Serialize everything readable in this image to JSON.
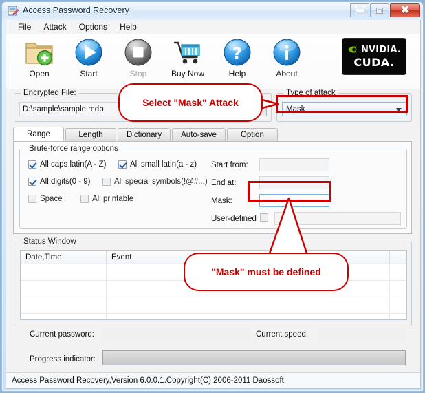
{
  "window": {
    "title": "Access Password Recovery",
    "icon": "app-icon",
    "buttons": {
      "minimize": "minimize",
      "maximize": "maximize",
      "close": "close"
    }
  },
  "menu": {
    "items": [
      {
        "label": "File"
      },
      {
        "label": "Attack"
      },
      {
        "label": "Options"
      },
      {
        "label": "Help"
      }
    ]
  },
  "toolbar": {
    "buttons": [
      {
        "label": "Open",
        "icon": "open-folder-icon",
        "disabled": false
      },
      {
        "label": "Start",
        "icon": "play-icon",
        "disabled": false
      },
      {
        "label": "Stop",
        "icon": "stop-icon",
        "disabled": true
      },
      {
        "label": "Buy Now",
        "icon": "shopping-cart-icon",
        "disabled": false
      },
      {
        "label": "Help",
        "icon": "question-mark-icon",
        "disabled": false
      },
      {
        "label": "About",
        "icon": "info-icon",
        "disabled": false
      }
    ],
    "cuda_badge": {
      "brand": "NVIDIA.",
      "product": "CUDA.",
      "logo_color": "#76b900",
      "background": "#080808"
    }
  },
  "encrypted_file": {
    "caption": "Encrypted File:",
    "path_value": "D:\\sample\\sample.mdb",
    "browse_label": "..."
  },
  "attack_type": {
    "caption": "Type of attack",
    "selected": "Mask"
  },
  "tabs": [
    {
      "label": "Range",
      "active": true
    },
    {
      "label": "Length",
      "active": false
    },
    {
      "label": "Dictionary",
      "active": false
    },
    {
      "label": "Auto-save",
      "active": false
    },
    {
      "label": "Option",
      "active": false
    }
  ],
  "range_tab": {
    "group_caption": "Brute-force range options",
    "checkboxes": [
      {
        "label": "All caps latin(A - Z)",
        "checked": true
      },
      {
        "label": "All small latin(a - z)",
        "checked": true
      },
      {
        "label": "All digits(0 - 9)",
        "checked": true
      },
      {
        "label": "All special symbols(!@#...)",
        "checked": false
      },
      {
        "label": "Space",
        "checked": false
      },
      {
        "label": "All printable",
        "checked": false
      }
    ],
    "fields": [
      {
        "label": "Start from:",
        "value": "",
        "enabled": false
      },
      {
        "label": "End at:",
        "value": "",
        "enabled": false
      },
      {
        "label": "Mask:",
        "value": "",
        "enabled": true
      }
    ],
    "user_defined": {
      "label": "User-defined",
      "checked": false,
      "value": ""
    }
  },
  "status_window": {
    "caption": "Status Window",
    "columns": [
      "Date,Time",
      "Event"
    ],
    "rows": []
  },
  "footer": {
    "current_password_label": "Current password:",
    "current_password_value": "",
    "current_speed_label": "Current speed:",
    "current_speed_value": "",
    "progress_label": "Progress indicator:",
    "progress_percent": 0
  },
  "statusbar": {
    "text": "Access Password Recovery,Version 6.0.0.1.Copyright(C) 2006-2011 Daossoft."
  },
  "annotations": {
    "color": "#cc0000",
    "callout_1": "Select \"Mask\" Attack",
    "callout_2": "\"Mask\" must be defined"
  }
}
